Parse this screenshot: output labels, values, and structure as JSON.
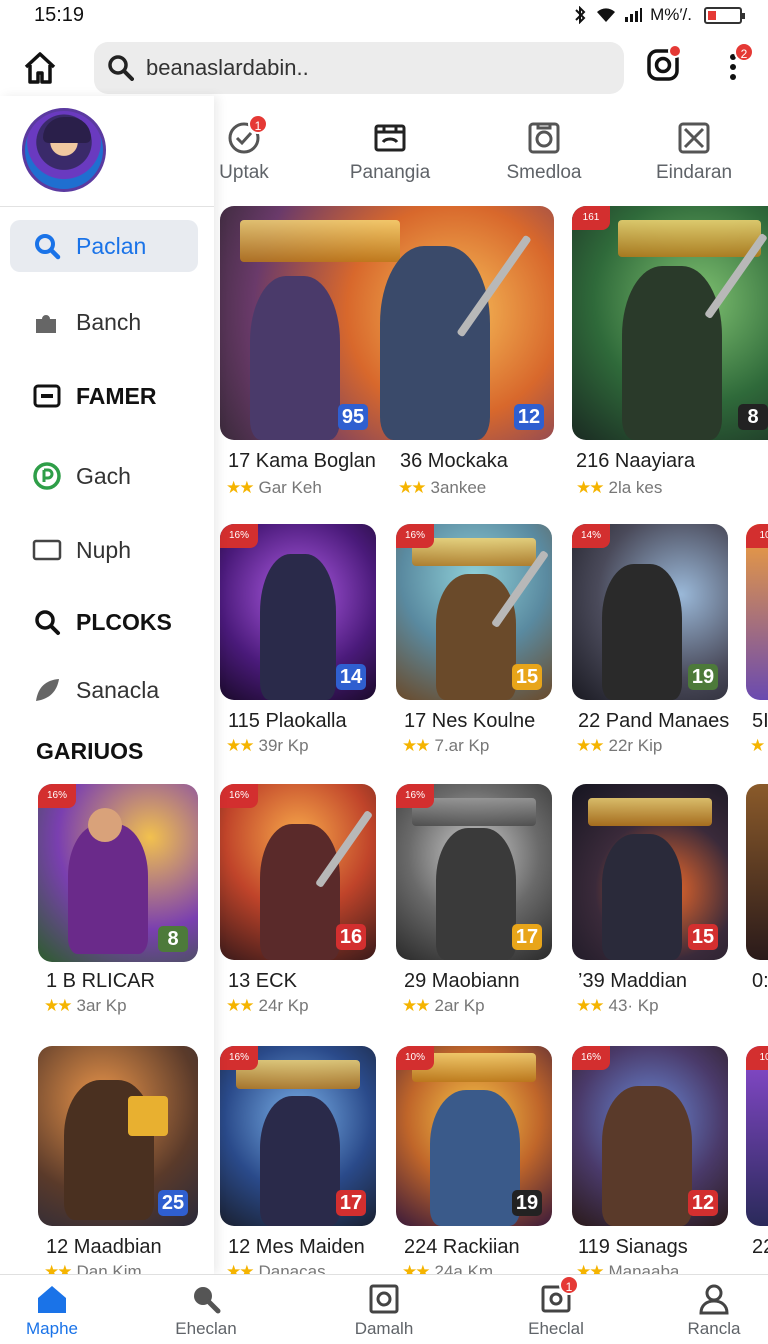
{
  "status": {
    "time": "15:19",
    "right_text": "M%′/.",
    "battery": 0.2
  },
  "search": {
    "query": "beanaslardabin.."
  },
  "header": {
    "more_badge": "2"
  },
  "drawer": {
    "menu": [
      {
        "label": "Paclan",
        "icon": "search-icon"
      },
      {
        "label": "Banch",
        "icon": "puzzle-icon"
      },
      {
        "label": "FAMER",
        "icon": "card-icon"
      },
      {
        "label": "Gach",
        "icon": "play-circle-icon"
      },
      {
        "label": "Nuph",
        "icon": "window-icon"
      },
      {
        "label": "PLCOKS",
        "icon": "search-icon"
      },
      {
        "label": "Sanacla",
        "icon": "leaf-icon"
      }
    ],
    "section_title": "GARIUOS"
  },
  "tabs": [
    {
      "label": "Uptak",
      "icon": "check-circle-icon",
      "badge": "1"
    },
    {
      "label": "Panangia",
      "icon": "theater-icon"
    },
    {
      "label": "Smedloa",
      "icon": "camera-icon"
    },
    {
      "label": "Eindaran",
      "icon": "close-box-icon"
    }
  ],
  "games": {
    "row1": [
      {
        "name": "17 Kama Boglan",
        "sub": "Gar Keh",
        "level": "95",
        "level_color": "#2f5fd0"
      },
      {
        "name": "36 Mockaka",
        "sub": "3ankee",
        "level": "12",
        "level_color": "#2f5fd0"
      },
      {
        "name": "216 Naayiara",
        "sub": "2la kes",
        "level": "8",
        "level_color": "#222222",
        "discount": "161"
      }
    ],
    "row2": [
      {
        "name": "115 Plaokalla",
        "sub": "39r Kp",
        "level": "14",
        "level_color": "#2f5fd0",
        "discount": "16%"
      },
      {
        "name": "17 Nes Koulne",
        "sub": "7.ar Kp",
        "level": "15",
        "level_color": "#e8a51a",
        "discount": "16%"
      },
      {
        "name": "22 Pand Manaes",
        "sub": "22r Kip",
        "level": "19",
        "level_color": "#4d7a3a",
        "discount": "14%"
      },
      {
        "name": "5I",
        "sub": "",
        "level": "",
        "level_color": "#2f5fd0",
        "discount": "10"
      }
    ],
    "row3": [
      {
        "name": "1 B RLICAR",
        "sub": "3ar Kp",
        "level": "8",
        "level_color": "#4d7a3a",
        "discount": "16%"
      },
      {
        "name": "13     ECK",
        "sub": "24r Kp",
        "level": "16",
        "level_color": "#d32f2f",
        "discount": "16%"
      },
      {
        "name": "29 Maobiann",
        "sub": "2ar Kp",
        "level": "17",
        "level_color": "#e8a51a",
        "discount": "16%"
      },
      {
        "name": "’39 Maddian",
        "sub": "43· Kp",
        "level": "15",
        "level_color": "#d32f2f"
      },
      {
        "name": "0:",
        "sub": "",
        "level": "",
        "level_color": "#d32f2f"
      }
    ],
    "row4": [
      {
        "name": "12 Maadbian",
        "sub": "Dan Kim",
        "level": "25",
        "level_color": "#2f5fd0"
      },
      {
        "name": "12 Mes Maiden",
        "sub": "Danacas",
        "level": "17",
        "level_color": "#d32f2f",
        "discount": "16%"
      },
      {
        "name": "224 Rackiian",
        "sub": "24a Km",
        "level": "19",
        "level_color": "#222222",
        "discount": "10%"
      },
      {
        "name": "119 Sianags",
        "sub": "Manaaba",
        "level": "12",
        "level_color": "#d32f2f",
        "discount": "16%"
      },
      {
        "name": "22",
        "sub": "",
        "level": "",
        "level_color": "#d32f2f",
        "discount": "10"
      }
    ]
  },
  "bottom_nav": [
    {
      "label": "Maphe",
      "icon": "home-icon",
      "active": true
    },
    {
      "label": "Eheclan",
      "icon": "search-icon"
    },
    {
      "label": "Damalh",
      "icon": "square-icon"
    },
    {
      "label": "Eheclal",
      "icon": "image-icon",
      "badge": "1"
    },
    {
      "label": "Rancla",
      "icon": "person-icon"
    }
  ]
}
